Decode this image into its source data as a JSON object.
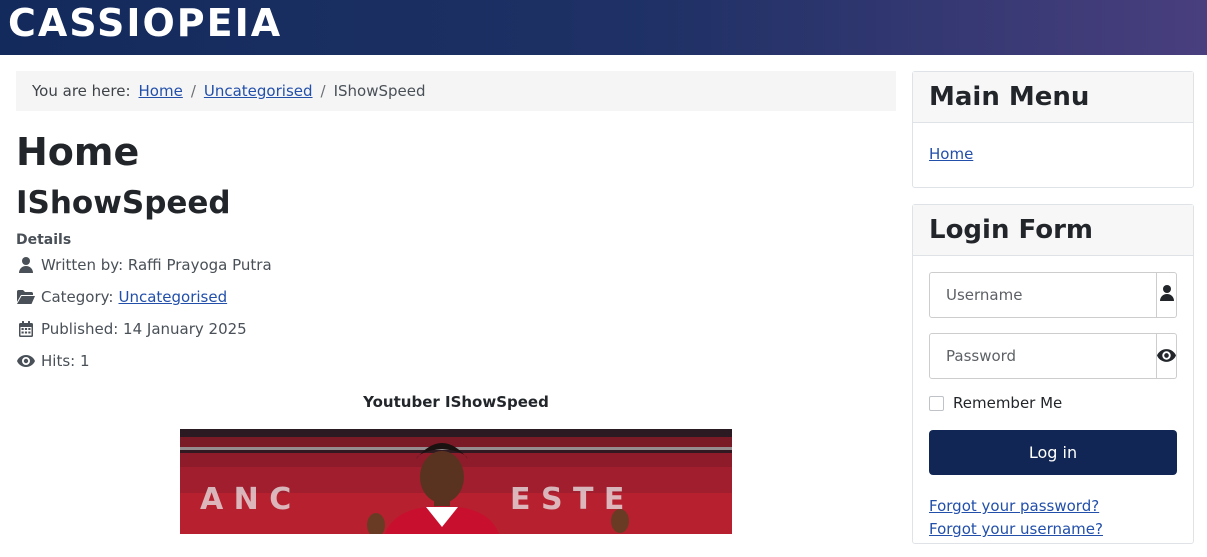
{
  "site": {
    "brand": "CASSIOPEIA"
  },
  "breadcrumb": {
    "prefix": "You are here:",
    "items": [
      "Home",
      "Uncategorised"
    ],
    "current": "IShowSpeed",
    "separator": "/"
  },
  "page": {
    "heading": "Home",
    "article_title": "IShowSpeed",
    "details_label": "Details",
    "author": "Written by: Raffi Prayoga Putra",
    "category_label": "Category:",
    "category_link": "Uncategorised",
    "published": "Published: 14 January 2025",
    "hits": "Hits: 1",
    "caption": "Youtuber IShowSpeed"
  },
  "sidebar": {
    "main_menu": {
      "title": "Main Menu",
      "items": [
        "Home"
      ]
    },
    "login": {
      "title": "Login Form",
      "username_placeholder": "Username",
      "password_placeholder": "Password",
      "remember_label": "Remember Me",
      "submit_label": "Log in",
      "forgot_password": "Forgot your password?",
      "forgot_username": "Forgot your username?"
    }
  },
  "colors": {
    "header_gradient_start": "#132a5c",
    "header_gradient_end": "#493f7e",
    "link": "#224faa",
    "button": "#112654"
  }
}
